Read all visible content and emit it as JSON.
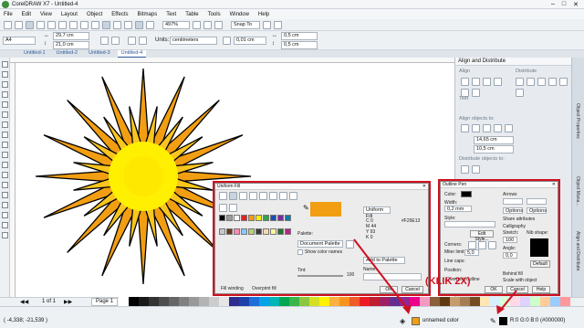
{
  "window": {
    "title": "CorelDRAW X7 - Untitled-4"
  },
  "menu": [
    "File",
    "Edit",
    "View",
    "Layout",
    "Object",
    "Effects",
    "Bitmaps",
    "Text",
    "Table",
    "Tools",
    "Window",
    "Help"
  ],
  "standard": {
    "zoom": "497%",
    "snap": "Snap To"
  },
  "property_bar": {
    "page_size": "A4",
    "width": "29,7 cm",
    "height": "21,0 cm",
    "units_label": "Units:",
    "units": "centimeters",
    "nudge": "0,01 cm",
    "dup_x": "0,5 cm",
    "dup_y": "0,5 cm"
  },
  "doc_tabs": [
    "Untitled-1",
    "Untitled-2",
    "Untitled-3",
    "Untitled-4"
  ],
  "docker": {
    "title": "Align and Distribute",
    "align_label": "Align",
    "distribute_label": "Distribute",
    "text_label": "Text",
    "align_objects_to": "Align objects to:",
    "x": "14,65 cm",
    "y": "10,5 cm",
    "distribute_objects_to": "Distribute objects to:"
  },
  "right_tabs": [
    "Object Properties",
    "Object Mana...",
    "Align and Distribute"
  ],
  "fill_dialog": {
    "title": "Uniform Fill",
    "palette_label": "Palette:",
    "palette_value": "Document Palette",
    "show_color_names": "Show color names",
    "model": "Uniform Fill",
    "hex": "#F29E13",
    "add_to_palette": "Add to Palette",
    "name_label": "Name:",
    "tint_label": "Tint:",
    "tint_value": "100",
    "fill_winding": "Fill winding",
    "overprint": "Overprint fill",
    "ok": "OK",
    "cancel": "Cancel",
    "help": "Help",
    "values": [
      {
        "k": "C",
        "v": "0"
      },
      {
        "k": "M",
        "v": "44"
      },
      {
        "k": "Y",
        "v": "93"
      },
      {
        "k": "K",
        "v": "0"
      }
    ],
    "swatches": [
      "#000000",
      "#9a9a9a",
      "#ffffff",
      "#e02424",
      "#f29e13",
      "#ffef00",
      "#2da84b",
      "#1b4fb5",
      "#7a2d9c",
      "#0a7ca8",
      "#c9c9c9",
      "#6b3a1d",
      "#ff8ab6",
      "#8cc8ff",
      "#b2d46a",
      "#3c3c3c",
      "#f5d9b0",
      "#f7f7a0",
      "#2e6e2e",
      "#bf1f8f"
    ]
  },
  "outline_dialog": {
    "title": "Outline Pen",
    "color_label": "Color:",
    "width_label": "Width:",
    "width_value": "0,2 mm",
    "style_label": "Style:",
    "edit_style": "Edit Style...",
    "corners_label": "Corners:",
    "miter_label": "Miter limit:",
    "miter_value": "5,0",
    "line_caps": "Line caps:",
    "position": "Position:",
    "overprint": "Overprint outline",
    "arrows_label": "Arrows",
    "options": "Options",
    "share": "Share attributes",
    "calligraphy": "Calligraphy",
    "stretch_label": "Stretch:",
    "stretch_value": "100",
    "nib_shape": "Nib shape:",
    "angle_label": "Angle:",
    "angle_value": "0,0",
    "default_btn": "Default",
    "behind_fill": "Behind fill",
    "scale_with": "Scale with object",
    "ok": "OK",
    "cancel": "Cancel",
    "help": "Help"
  },
  "pagebar": {
    "of": "1 of 1",
    "page": "Page 1"
  },
  "palette_colors": [
    "#ffffff",
    "#000000",
    "#1a1a1a",
    "#333333",
    "#4d4d4d",
    "#666666",
    "#808080",
    "#999999",
    "#b3b3b3",
    "#cccccc",
    "#e6e6e6",
    "#2d2d8f",
    "#1c3fa8",
    "#1b6fd6",
    "#00a2e8",
    "#00b5b5",
    "#00a651",
    "#39b54a",
    "#8dc63f",
    "#d7df23",
    "#fff200",
    "#fbb040",
    "#f7941d",
    "#f15a29",
    "#ed1c24",
    "#be1e2d",
    "#9e1f63",
    "#662d91",
    "#92278f",
    "#ec008c",
    "#f49ac1",
    "#8b5e3c",
    "#603913",
    "#c69c6d",
    "#a67c52",
    "#754c24",
    "#ffe6b3",
    "#d5f0ff",
    "#d9ffd9",
    "#ffd9e6",
    "#e0d2ff",
    "#ccffcc",
    "#ffcc99",
    "#99ccff",
    "#ff9999"
  ],
  "status": {
    "coords": "( -4,338; -21,539 )",
    "fill_name": "unnamed color",
    "outline": "R:0 G:0 B:0 (#000000)",
    "annotation": "(KLIK 2X)",
    "fill_color": "#F29E13"
  },
  "star_colors": {
    "petal_dark": "#F29E13",
    "petal_light": "#F9C51E",
    "center": "#FFEF00",
    "center_core": "#FFE800"
  }
}
